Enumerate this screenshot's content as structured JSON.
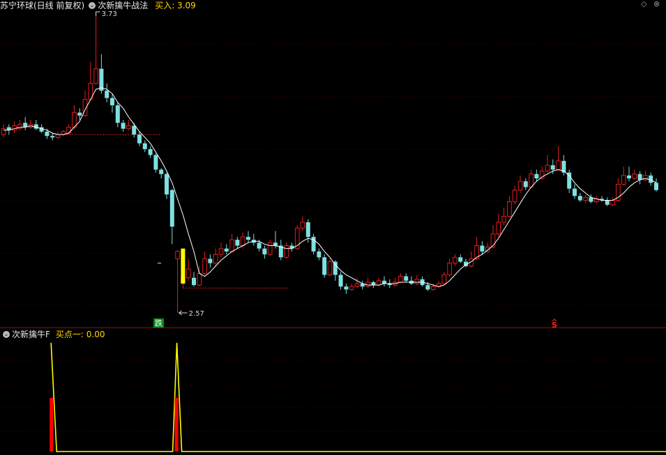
{
  "header": {
    "stock_title": "苏宁环球(日线 前复权)",
    "strategy_name": "次新擒牛战法",
    "buy_label": "买入: 3.09",
    "diamond_icon": "diamond-icon",
    "close_icon": "close-circle-icon"
  },
  "indicator_header": {
    "name": "次新擒牛F",
    "value_label": "买点一: 0.00"
  },
  "colors": {
    "up": "#e41e1e",
    "down": "#7ee0e0",
    "ma": "#ffffff",
    "signal": "#ffff00",
    "peak": "#ff0000",
    "grid": "#3a0000"
  },
  "chart_data": [
    {
      "type": "candlestick",
      "annotations": {
        "high_label": "3.73",
        "low_label": "2.57",
        "fall_badge": "跌",
        "s_marker": "S"
      },
      "candles": [
        [
          2.9,
          2.94,
          2.97,
          2.88
        ],
        [
          2.95,
          2.93,
          2.97,
          2.9
        ],
        [
          2.93,
          2.96,
          2.99,
          2.91
        ],
        [
          2.94,
          2.97,
          3.0,
          2.93
        ],
        [
          2.98,
          2.95,
          3.02,
          2.93
        ],
        [
          2.95,
          2.97,
          3.0,
          2.94
        ],
        [
          2.97,
          2.94,
          3.0,
          2.93
        ],
        [
          2.95,
          2.92,
          2.97,
          2.91
        ],
        [
          2.92,
          2.89,
          2.94,
          2.87
        ],
        [
          2.89,
          2.88,
          2.91,
          2.86
        ],
        [
          2.88,
          2.9,
          2.92,
          2.87
        ],
        [
          2.9,
          2.92,
          2.93,
          2.89
        ],
        [
          2.91,
          2.95,
          2.97,
          2.9
        ],
        [
          2.95,
          3.05,
          3.1,
          2.94
        ],
        [
          3.05,
          3.03,
          3.08,
          3.0
        ],
        [
          3.03,
          3.14,
          3.2,
          3.02
        ],
        [
          3.14,
          3.25,
          3.4,
          3.13
        ],
        [
          3.25,
          3.35,
          3.73,
          3.24
        ],
        [
          3.35,
          3.2,
          3.45,
          3.18
        ],
        [
          3.2,
          3.15,
          3.25,
          3.12
        ],
        [
          3.15,
          3.1,
          3.18,
          3.05
        ],
        [
          3.1,
          2.98,
          3.12,
          2.95
        ],
        [
          2.98,
          2.94,
          3.0,
          2.92
        ],
        [
          2.94,
          2.96,
          3.0,
          2.93
        ],
        [
          2.96,
          2.9,
          2.98,
          2.88
        ],
        [
          2.9,
          2.84,
          2.92,
          2.82
        ],
        [
          2.84,
          2.8,
          2.86,
          2.78
        ],
        [
          2.8,
          2.76,
          2.82,
          2.74
        ],
        [
          2.76,
          2.66,
          2.77,
          2.64
        ],
        [
          2.66,
          2.63,
          2.67,
          2.6
        ],
        [
          2.63,
          2.49,
          2.64,
          2.46
        ],
        [
          2.52,
          2.27,
          2.53,
          2.15
        ],
        [
          2.05,
          2.1,
          2.11,
          1.68
        ],
        [
          1.89,
          1.92,
          2.02,
          1.85
        ],
        [
          1.92,
          1.98,
          2.05,
          1.9
        ],
        [
          1.92,
          1.87,
          1.96,
          1.86
        ],
        [
          1.87,
          1.95,
          2.0,
          1.86
        ],
        [
          1.95,
          2.05,
          2.1,
          1.94
        ],
        [
          2.05,
          2.02,
          2.08,
          1.99
        ],
        [
          2.02,
          2.08,
          2.12,
          2.0
        ],
        [
          2.08,
          2.12,
          2.16,
          2.06
        ],
        [
          2.12,
          2.1,
          2.15,
          2.08
        ],
        [
          2.1,
          2.18,
          2.22,
          2.09
        ],
        [
          2.18,
          2.14,
          2.2,
          2.12
        ],
        [
          2.14,
          2.2,
          2.23,
          2.12
        ],
        [
          2.2,
          2.18,
          2.24,
          2.16
        ],
        [
          2.18,
          2.16,
          2.22,
          2.14
        ],
        [
          2.16,
          2.12,
          2.18,
          2.1
        ],
        [
          2.12,
          2.08,
          2.14,
          2.05
        ],
        [
          2.08,
          2.16,
          2.18,
          2.07
        ],
        [
          2.16,
          2.14,
          2.24,
          2.12
        ],
        [
          2.14,
          2.06,
          2.18,
          2.04
        ],
        [
          2.06,
          2.14,
          2.16,
          2.05
        ],
        [
          2.14,
          2.12,
          2.16,
          2.1
        ],
        [
          2.12,
          2.26,
          2.28,
          2.11
        ],
        [
          2.26,
          2.3,
          2.34,
          2.24
        ],
        [
          2.3,
          2.2,
          2.32,
          2.16
        ],
        [
          2.2,
          2.1,
          2.22,
          2.08
        ],
        [
          2.1,
          2.06,
          2.12,
          2.04
        ],
        [
          2.06,
          1.94,
          2.08,
          1.92
        ],
        [
          1.94,
          2.03,
          2.05,
          1.93
        ],
        [
          2.03,
          1.94,
          2.04,
          1.9
        ],
        [
          1.94,
          1.86,
          1.96,
          1.84
        ],
        [
          1.86,
          1.84,
          1.88,
          1.81
        ],
        [
          1.84,
          1.86,
          1.88,
          1.83
        ],
        [
          1.86,
          1.88,
          1.92,
          1.85
        ],
        [
          1.88,
          1.86,
          1.9,
          1.84
        ],
        [
          1.86,
          1.89,
          1.92,
          1.85
        ],
        [
          1.89,
          1.87,
          1.9,
          1.85
        ],
        [
          1.87,
          1.9,
          1.92,
          1.86
        ],
        [
          1.9,
          1.88,
          1.93,
          1.86
        ],
        [
          1.88,
          1.87,
          1.91,
          1.85
        ],
        [
          1.87,
          1.89,
          1.92,
          1.86
        ],
        [
          1.89,
          1.93,
          1.95,
          1.88
        ],
        [
          1.93,
          1.9,
          1.95,
          1.89
        ],
        [
          1.9,
          1.88,
          1.93,
          1.87
        ],
        [
          1.88,
          1.91,
          1.94,
          1.87
        ],
        [
          1.91,
          1.87,
          1.93,
          1.86
        ],
        [
          1.87,
          1.84,
          1.89,
          1.83
        ],
        [
          1.84,
          1.86,
          1.88,
          1.83
        ],
        [
          1.86,
          1.88,
          1.9,
          1.85
        ],
        [
          1.88,
          1.94,
          1.96,
          1.87
        ],
        [
          1.94,
          2.02,
          2.05,
          1.93
        ],
        [
          2.02,
          2.06,
          2.08,
          2.0
        ],
        [
          2.06,
          2.03,
          2.08,
          2.02
        ],
        [
          2.03,
          2.0,
          2.05,
          1.99
        ],
        [
          2.0,
          2.05,
          2.1,
          1.99
        ],
        [
          2.05,
          2.14,
          2.2,
          2.04
        ],
        [
          2.14,
          2.1,
          2.17,
          2.08
        ],
        [
          2.1,
          2.13,
          2.16,
          2.09
        ],
        [
          2.13,
          2.22,
          2.28,
          2.12
        ],
        [
          2.22,
          2.3,
          2.36,
          2.2
        ],
        [
          2.3,
          2.34,
          2.4,
          2.28
        ],
        [
          2.34,
          2.44,
          2.48,
          2.33
        ],
        [
          2.44,
          2.52,
          2.55,
          2.42
        ],
        [
          2.52,
          2.58,
          2.62,
          2.5
        ],
        [
          2.58,
          2.54,
          2.6,
          2.52
        ],
        [
          2.54,
          2.63,
          2.66,
          2.53
        ],
        [
          2.63,
          2.6,
          2.66,
          2.58
        ],
        [
          2.6,
          2.65,
          2.68,
          2.59
        ],
        [
          2.65,
          2.69,
          2.76,
          2.64
        ],
        [
          2.69,
          2.66,
          2.73,
          2.63
        ],
        [
          2.66,
          2.72,
          2.82,
          2.65
        ],
        [
          2.72,
          2.64,
          2.76,
          2.62
        ],
        [
          2.64,
          2.53,
          2.66,
          2.5
        ],
        [
          2.53,
          2.48,
          2.56,
          2.46
        ],
        [
          2.48,
          2.45,
          2.5,
          2.44
        ],
        [
          2.45,
          2.47,
          2.49,
          2.43
        ],
        [
          2.47,
          2.44,
          2.49,
          2.43
        ],
        [
          2.44,
          2.46,
          2.48,
          2.43
        ],
        [
          2.46,
          2.45,
          2.48,
          2.44
        ],
        [
          2.45,
          2.42,
          2.47,
          2.41
        ],
        [
          2.42,
          2.45,
          2.47,
          2.41
        ],
        [
          2.45,
          2.56,
          2.6,
          2.44
        ],
        [
          2.56,
          2.62,
          2.68,
          2.55
        ],
        [
          2.62,
          2.6,
          2.68,
          2.58
        ],
        [
          2.6,
          2.63,
          2.66,
          2.59
        ],
        [
          2.63,
          2.59,
          2.65,
          2.56
        ],
        [
          2.59,
          2.62,
          2.65,
          2.58
        ],
        [
          2.62,
          2.57,
          2.64,
          2.55
        ],
        [
          2.57,
          2.52,
          2.6,
          2.51
        ]
      ],
      "ma": [
        2.93,
        2.93,
        2.94,
        2.95,
        2.95,
        2.96,
        2.95,
        2.94,
        2.93,
        2.91,
        2.9,
        2.9,
        2.91,
        2.95,
        2.99,
        3.07,
        3.14,
        3.21,
        3.22,
        3.21,
        3.18,
        3.12,
        3.08,
        3.02,
        2.97,
        2.92,
        2.88,
        2.84,
        2.78,
        2.72,
        2.65,
        2.57,
        2.46,
        2.35,
        2.22,
        2.1,
        1.95,
        1.93,
        1.96,
        2.0,
        2.04,
        2.07,
        2.1,
        2.12,
        2.14,
        2.16,
        2.17,
        2.17,
        2.15,
        2.14,
        2.14,
        2.13,
        2.12,
        2.12,
        2.14,
        2.17,
        2.19,
        2.18,
        2.15,
        2.1,
        2.06,
        2.01,
        1.97,
        1.94,
        1.92,
        1.9,
        1.88,
        1.87,
        1.87,
        1.87,
        1.88,
        1.88,
        1.88,
        1.89,
        1.89,
        1.89,
        1.89,
        1.89,
        1.88,
        1.87,
        1.86,
        1.87,
        1.9,
        1.94,
        1.98,
        2.01,
        2.03,
        2.06,
        2.08,
        2.11,
        2.14,
        2.19,
        2.25,
        2.31,
        2.37,
        2.43,
        2.49,
        2.54,
        2.58,
        2.61,
        2.63,
        2.65,
        2.66,
        2.65,
        2.62,
        2.57,
        2.53,
        2.5,
        2.47,
        2.46,
        2.45,
        2.45,
        2.45,
        2.47,
        2.5,
        2.54,
        2.57,
        2.59,
        2.6,
        2.59,
        2.57
      ],
      "support_levels": [
        2.9,
        1.85
      ]
    },
    {
      "type": "line",
      "name": "买点一",
      "signal_indices": [
        9,
        32
      ],
      "values_note": "spikes to 1 at signal bars, 0 elsewhere"
    }
  ]
}
